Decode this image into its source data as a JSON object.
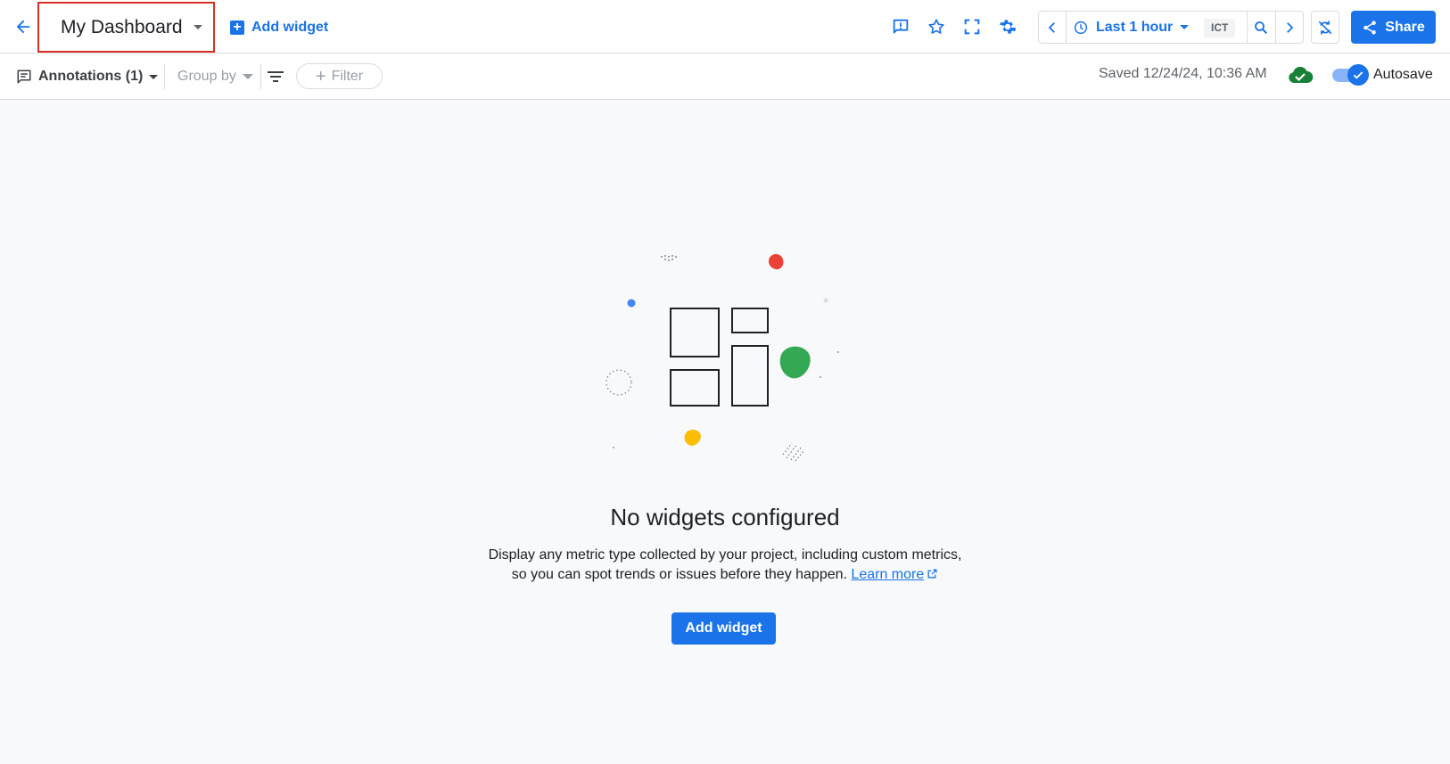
{
  "header": {
    "title": "My Dashboard",
    "add_widget_label": "Add widget",
    "icons": [
      "back-arrow-icon",
      "feedback-icon",
      "star-icon",
      "fullscreen-icon",
      "settings-gear-icon",
      "chevron-left-icon",
      "clock-icon",
      "zoom-icon",
      "chevron-right-icon",
      "auto-refresh-off-icon",
      "share-icon"
    ],
    "time_range_label": "Last 1 hour",
    "timezone": "ICT",
    "share_label": "Share"
  },
  "toolbar": {
    "annotations_label": "Annotations (1)",
    "group_by_label": "Group by",
    "filter_label": "Filter",
    "saved_text": "Saved 12/24/24, 10:36 AM",
    "autosave_label": "Autosave",
    "autosave_on": true
  },
  "empty_state": {
    "title": "No widgets configured",
    "desc_line1": "Display any metric type collected by your project, including custom metrics,",
    "desc_line2": "so you can spot trends or issues before they happen.",
    "learn_more": "Learn more",
    "button_label": "Add widget"
  },
  "colors": {
    "accent": "#1a73e8",
    "highlight_border": "#d93025",
    "cloud_ok": "#188038",
    "dot_red": "#ea4335",
    "dot_green": "#34a853",
    "dot_yellow": "#fbbc04"
  }
}
